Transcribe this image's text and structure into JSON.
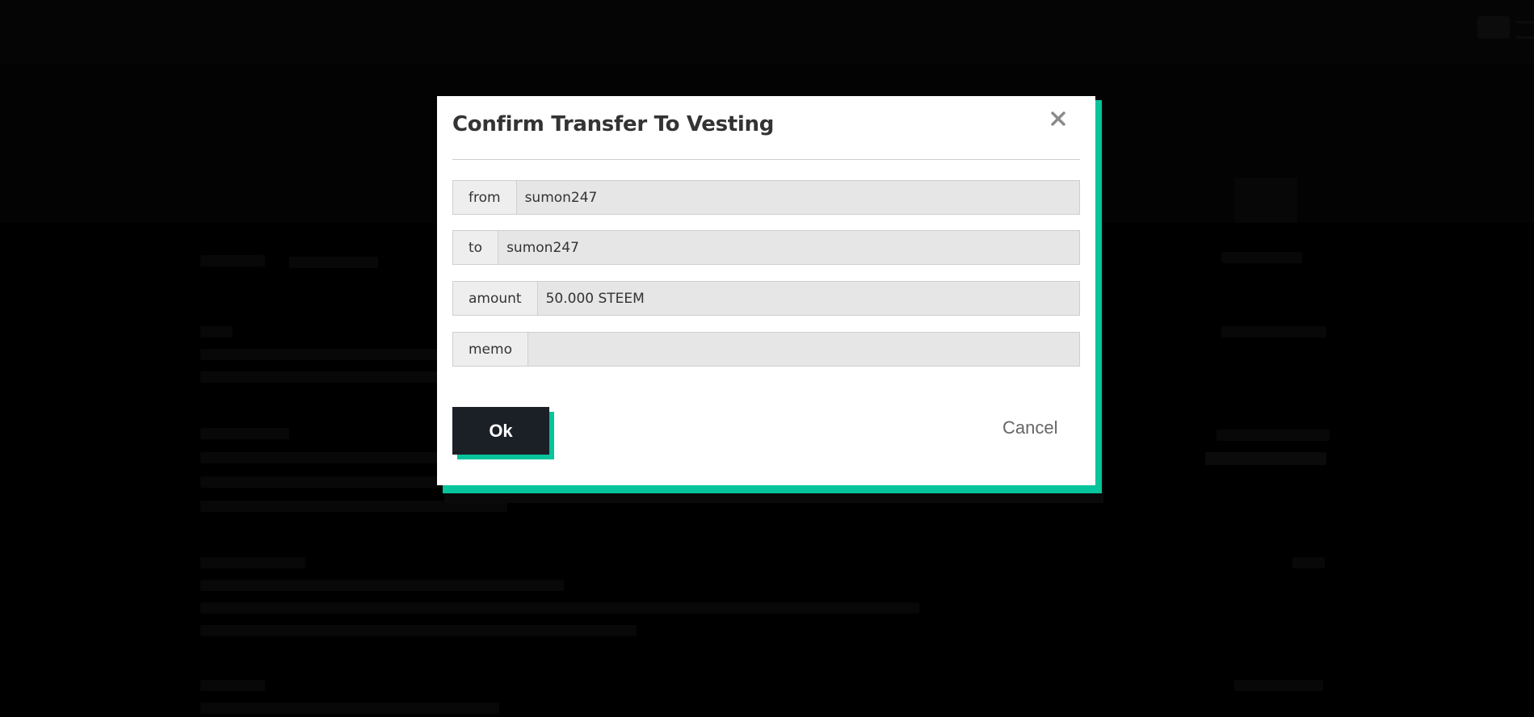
{
  "dialog": {
    "title": "Confirm Transfer To Vesting",
    "close_icon": "close-icon",
    "fields": [
      {
        "label": "from",
        "value": "sumon247",
        "placeholder": ""
      },
      {
        "label": "to",
        "value": "sumon247",
        "placeholder": ""
      },
      {
        "label": "amount",
        "value": "50.000 STEEM",
        "placeholder": ""
      },
      {
        "label": "memo",
        "value": "",
        "placeholder": ""
      }
    ],
    "ok_label": "Ok",
    "cancel_label": "Cancel"
  },
  "colors": {
    "accent": "#06c49b",
    "ok_button": "#1b2027",
    "overlay": "#000000"
  }
}
